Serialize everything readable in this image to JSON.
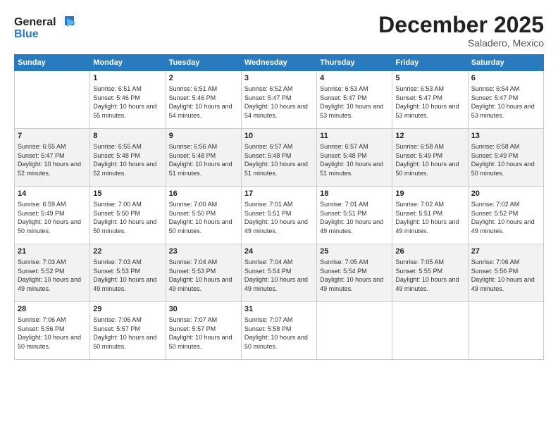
{
  "logo": {
    "line1": "General",
    "line2": "Blue"
  },
  "title": "December 2025",
  "subtitle": "Saladero, Mexico",
  "days_of_week": [
    "Sunday",
    "Monday",
    "Tuesday",
    "Wednesday",
    "Thursday",
    "Friday",
    "Saturday"
  ],
  "weeks": [
    [
      {
        "day": "",
        "sunrise": "",
        "sunset": "",
        "daylight": ""
      },
      {
        "day": "1",
        "sunrise": "Sunrise: 6:51 AM",
        "sunset": "Sunset: 5:46 PM",
        "daylight": "Daylight: 10 hours and 55 minutes."
      },
      {
        "day": "2",
        "sunrise": "Sunrise: 6:51 AM",
        "sunset": "Sunset: 5:46 PM",
        "daylight": "Daylight: 10 hours and 54 minutes."
      },
      {
        "day": "3",
        "sunrise": "Sunrise: 6:52 AM",
        "sunset": "Sunset: 5:47 PM",
        "daylight": "Daylight: 10 hours and 54 minutes."
      },
      {
        "day": "4",
        "sunrise": "Sunrise: 6:53 AM",
        "sunset": "Sunset: 5:47 PM",
        "daylight": "Daylight: 10 hours and 53 minutes."
      },
      {
        "day": "5",
        "sunrise": "Sunrise: 6:53 AM",
        "sunset": "Sunset: 5:47 PM",
        "daylight": "Daylight: 10 hours and 53 minutes."
      },
      {
        "day": "6",
        "sunrise": "Sunrise: 6:54 AM",
        "sunset": "Sunset: 5:47 PM",
        "daylight": "Daylight: 10 hours and 53 minutes."
      }
    ],
    [
      {
        "day": "7",
        "sunrise": "Sunrise: 6:55 AM",
        "sunset": "Sunset: 5:47 PM",
        "daylight": "Daylight: 10 hours and 52 minutes."
      },
      {
        "day": "8",
        "sunrise": "Sunrise: 6:55 AM",
        "sunset": "Sunset: 5:48 PM",
        "daylight": "Daylight: 10 hours and 52 minutes."
      },
      {
        "day": "9",
        "sunrise": "Sunrise: 6:56 AM",
        "sunset": "Sunset: 5:48 PM",
        "daylight": "Daylight: 10 hours and 51 minutes."
      },
      {
        "day": "10",
        "sunrise": "Sunrise: 6:57 AM",
        "sunset": "Sunset: 5:48 PM",
        "daylight": "Daylight: 10 hours and 51 minutes."
      },
      {
        "day": "11",
        "sunrise": "Sunrise: 6:57 AM",
        "sunset": "Sunset: 5:48 PM",
        "daylight": "Daylight: 10 hours and 51 minutes."
      },
      {
        "day": "12",
        "sunrise": "Sunrise: 6:58 AM",
        "sunset": "Sunset: 5:49 PM",
        "daylight": "Daylight: 10 hours and 50 minutes."
      },
      {
        "day": "13",
        "sunrise": "Sunrise: 6:58 AM",
        "sunset": "Sunset: 5:49 PM",
        "daylight": "Daylight: 10 hours and 50 minutes."
      }
    ],
    [
      {
        "day": "14",
        "sunrise": "Sunrise: 6:59 AM",
        "sunset": "Sunset: 5:49 PM",
        "daylight": "Daylight: 10 hours and 50 minutes."
      },
      {
        "day": "15",
        "sunrise": "Sunrise: 7:00 AM",
        "sunset": "Sunset: 5:50 PM",
        "daylight": "Daylight: 10 hours and 50 minutes."
      },
      {
        "day": "16",
        "sunrise": "Sunrise: 7:00 AM",
        "sunset": "Sunset: 5:50 PM",
        "daylight": "Daylight: 10 hours and 50 minutes."
      },
      {
        "day": "17",
        "sunrise": "Sunrise: 7:01 AM",
        "sunset": "Sunset: 5:51 PM",
        "daylight": "Daylight: 10 hours and 49 minutes."
      },
      {
        "day": "18",
        "sunrise": "Sunrise: 7:01 AM",
        "sunset": "Sunset: 5:51 PM",
        "daylight": "Daylight: 10 hours and 49 minutes."
      },
      {
        "day": "19",
        "sunrise": "Sunrise: 7:02 AM",
        "sunset": "Sunset: 5:51 PM",
        "daylight": "Daylight: 10 hours and 49 minutes."
      },
      {
        "day": "20",
        "sunrise": "Sunrise: 7:02 AM",
        "sunset": "Sunset: 5:52 PM",
        "daylight": "Daylight: 10 hours and 49 minutes."
      }
    ],
    [
      {
        "day": "21",
        "sunrise": "Sunrise: 7:03 AM",
        "sunset": "Sunset: 5:52 PM",
        "daylight": "Daylight: 10 hours and 49 minutes."
      },
      {
        "day": "22",
        "sunrise": "Sunrise: 7:03 AM",
        "sunset": "Sunset: 5:53 PM",
        "daylight": "Daylight: 10 hours and 49 minutes."
      },
      {
        "day": "23",
        "sunrise": "Sunrise: 7:04 AM",
        "sunset": "Sunset: 5:53 PM",
        "daylight": "Daylight: 10 hours and 49 minutes."
      },
      {
        "day": "24",
        "sunrise": "Sunrise: 7:04 AM",
        "sunset": "Sunset: 5:54 PM",
        "daylight": "Daylight: 10 hours and 49 minutes."
      },
      {
        "day": "25",
        "sunrise": "Sunrise: 7:05 AM",
        "sunset": "Sunset: 5:54 PM",
        "daylight": "Daylight: 10 hours and 49 minutes."
      },
      {
        "day": "26",
        "sunrise": "Sunrise: 7:05 AM",
        "sunset": "Sunset: 5:55 PM",
        "daylight": "Daylight: 10 hours and 49 minutes."
      },
      {
        "day": "27",
        "sunrise": "Sunrise: 7:06 AM",
        "sunset": "Sunset: 5:56 PM",
        "daylight": "Daylight: 10 hours and 49 minutes."
      }
    ],
    [
      {
        "day": "28",
        "sunrise": "Sunrise: 7:06 AM",
        "sunset": "Sunset: 5:56 PM",
        "daylight": "Daylight: 10 hours and 50 minutes."
      },
      {
        "day": "29",
        "sunrise": "Sunrise: 7:06 AM",
        "sunset": "Sunset: 5:57 PM",
        "daylight": "Daylight: 10 hours and 50 minutes."
      },
      {
        "day": "30",
        "sunrise": "Sunrise: 7:07 AM",
        "sunset": "Sunset: 5:57 PM",
        "daylight": "Daylight: 10 hours and 50 minutes."
      },
      {
        "day": "31",
        "sunrise": "Sunrise: 7:07 AM",
        "sunset": "Sunset: 5:58 PM",
        "daylight": "Daylight: 10 hours and 50 minutes."
      },
      {
        "day": "",
        "sunrise": "",
        "sunset": "",
        "daylight": ""
      },
      {
        "day": "",
        "sunrise": "",
        "sunset": "",
        "daylight": ""
      },
      {
        "day": "",
        "sunrise": "",
        "sunset": "",
        "daylight": ""
      }
    ]
  ]
}
